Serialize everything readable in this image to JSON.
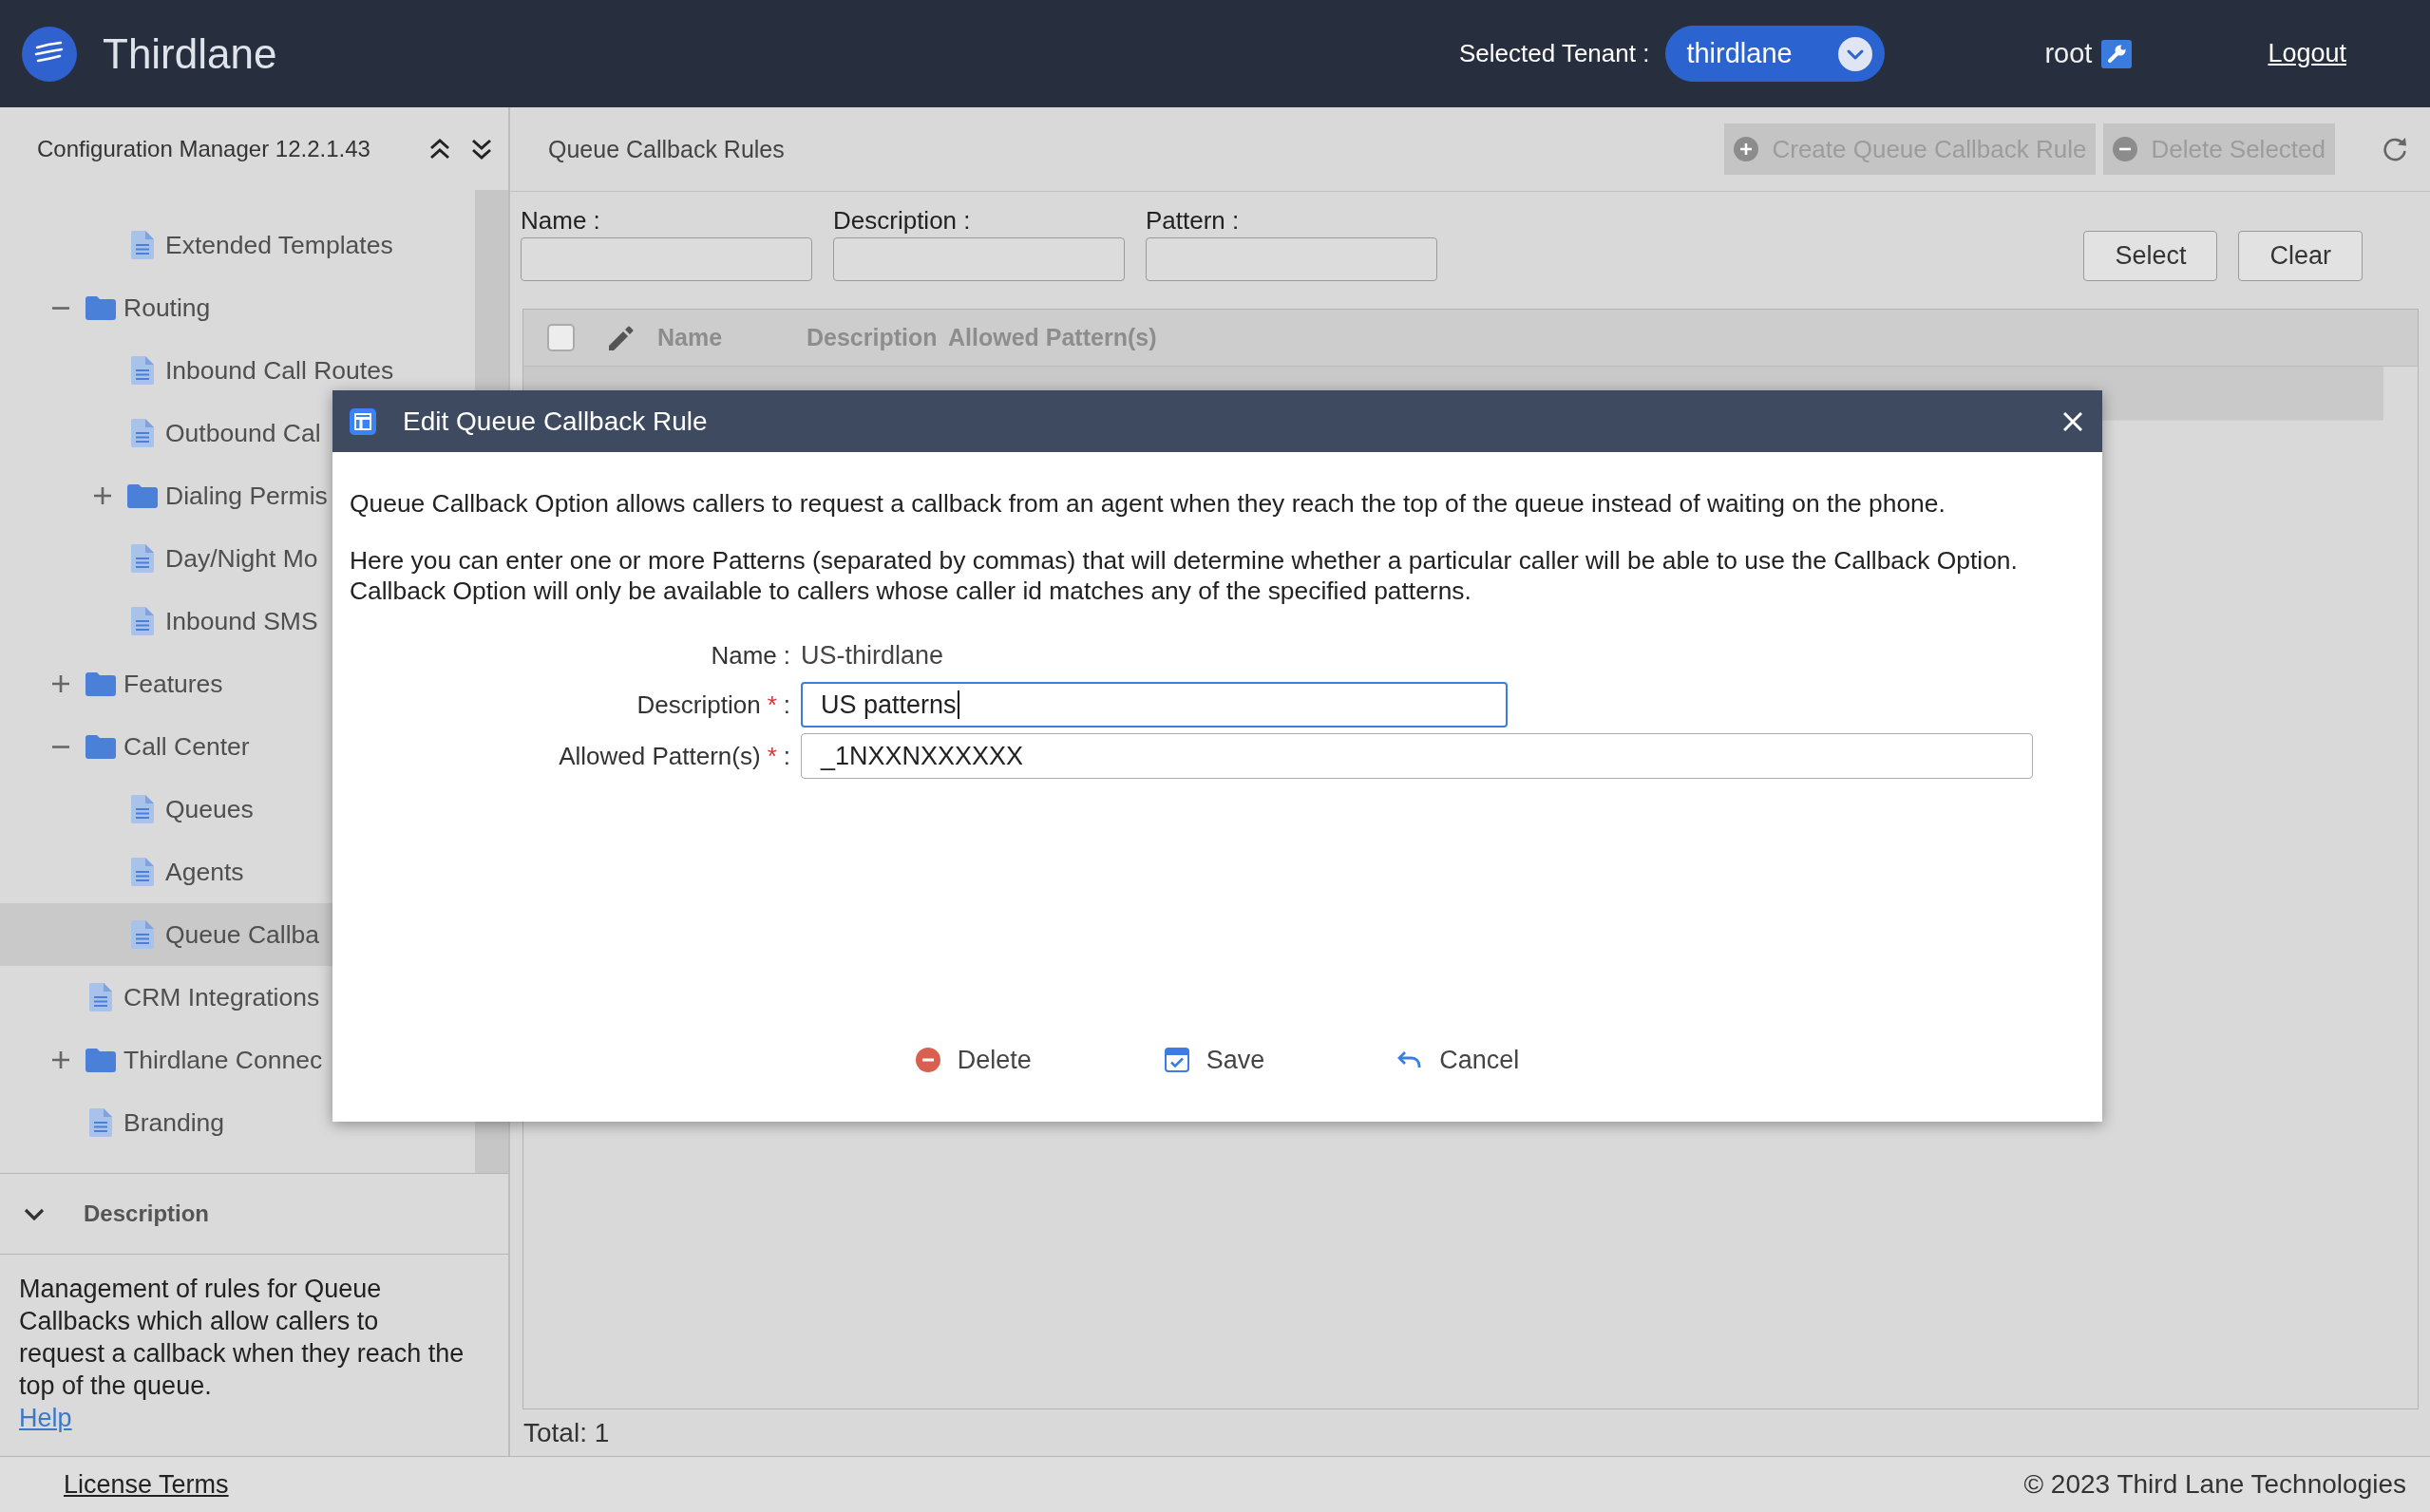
{
  "header": {
    "brand": "Thirdlane",
    "tenant_label": "Selected Tenant :",
    "tenant": "thirdlane",
    "user": "root",
    "logout": "Logout"
  },
  "sidebar": {
    "title": "Configuration Manager 12.2.1.43",
    "tree": [
      {
        "children": [
          {
            "label": "Extended Templates",
            "kind": "page",
            "selected": false
          }
        ]
      },
      {
        "label": "Routing",
        "kind": "folder",
        "expanded": true,
        "selected": false,
        "children": [
          {
            "label": "Inbound Call Routes",
            "kind": "page",
            "selected": false
          },
          {
            "label": "Outbound Cal",
            "kind": "page",
            "selected": false
          },
          {
            "label": "Dialing Permis",
            "kind": "folder",
            "expanded": false,
            "selected": false
          },
          {
            "label": "Day/Night Mo",
            "kind": "page",
            "selected": false
          },
          {
            "label": "Inbound SMS",
            "kind": "page",
            "selected": false
          }
        ]
      },
      {
        "label": "Features",
        "kind": "folder",
        "expanded": false,
        "selected": false
      },
      {
        "label": "Call Center",
        "kind": "folder",
        "expanded": true,
        "selected": false,
        "children": [
          {
            "label": "Queues",
            "kind": "page",
            "selected": false
          },
          {
            "label": "Agents",
            "kind": "page",
            "selected": false
          },
          {
            "label": "Queue Callba",
            "kind": "page",
            "selected": true
          }
        ]
      },
      {
        "label": "CRM Integrations",
        "kind": "page",
        "selected": false
      },
      {
        "label": "Thirdlane Connec",
        "kind": "folder",
        "expanded": false,
        "selected": false
      },
      {
        "label": "Branding",
        "kind": "page",
        "selected": false
      }
    ],
    "description": {
      "title": "Description",
      "expanded": true,
      "text": "Management of rules for Queue Callbacks which allow callers to request a callback when they reach the top of the queue.",
      "link": "Help"
    }
  },
  "main": {
    "title": "Queue Callback Rules",
    "toolbar": [
      {
        "label": "Create Queue Callback Rule",
        "kind": "create",
        "disabled": true
      },
      {
        "label": "Delete Selected",
        "kind": "delete",
        "disabled": true
      }
    ],
    "filters": [
      {
        "label": "Name :"
      },
      {
        "label": "Description :"
      },
      {
        "label": "Pattern :"
      }
    ],
    "filter_buttons": [
      "Select",
      "Clear"
    ],
    "table": {
      "select_all": {
        "checked": false
      },
      "columns": [
        "Name",
        "Description",
        "Allowed Pattern(s)"
      ],
      "rows": [
        {
          "selected": true
        }
      ]
    },
    "total": "Total: 1"
  },
  "dialog": {
    "title": "Edit Queue Callback Rule",
    "paragraphs": [
      "Queue Callback Option allows callers to request a callback from an agent when they reach the top of the queue instead of waiting on the phone.",
      "Here you can enter one or more Patterns (separated by commas) that will determine whether a particular caller will be able to use the Callback Option. Callback Option will only be available to callers whose caller id matches any of the specified patterns."
    ],
    "fields": [
      {
        "label": "Name",
        "separator": ":",
        "kind": "text",
        "value": "US-thirdlane"
      },
      {
        "label": "Description",
        "required_mark": "*",
        "separator": ":",
        "kind": "input",
        "value": "US patterns",
        "focused": true
      },
      {
        "label": "Allowed Pattern(s)",
        "required_mark": "*",
        "separator": ":",
        "kind": "input",
        "value": "_1NXXNXXXXXX",
        "focused": false
      }
    ],
    "buttons": [
      {
        "label": "Delete",
        "kind": "delete"
      },
      {
        "label": "Save",
        "kind": "save"
      },
      {
        "label": "Cancel",
        "kind": "cancel"
      }
    ]
  },
  "footer": {
    "license": "License Terms",
    "copyright": "© 2023 Third Lane Technologies"
  }
}
